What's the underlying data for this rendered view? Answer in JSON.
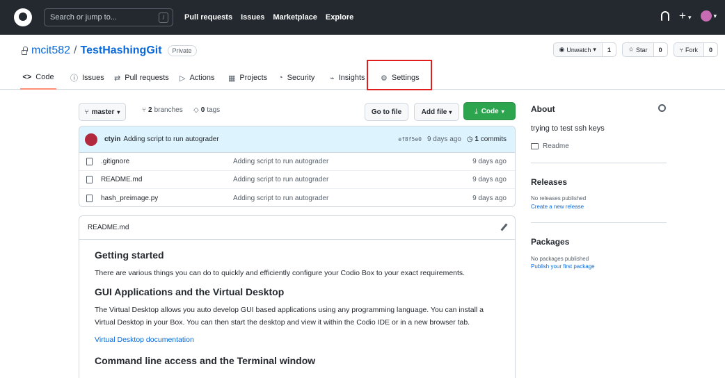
{
  "topbar": {
    "search_placeholder": "Search or jump to...",
    "slash_key": "/",
    "nav": [
      "Pull requests",
      "Issues",
      "Marketplace",
      "Explore"
    ],
    "plus_icon": "+"
  },
  "repo": {
    "owner": "mcit582",
    "separator": "/",
    "name": "TestHashingGit",
    "visibility": "Private",
    "unwatch_label": "Unwatch",
    "unwatch_count": "1",
    "star_label": "Star",
    "star_count": "0",
    "fork_label": "Fork",
    "fork_count": "0"
  },
  "tabs": [
    {
      "label": "Code",
      "icon": "<>"
    },
    {
      "label": "Issues",
      "icon": "ⓘ"
    },
    {
      "label": "Pull requests",
      "icon": "⇄"
    },
    {
      "label": "Actions",
      "icon": "▷"
    },
    {
      "label": "Projects",
      "icon": "▦"
    },
    {
      "label": "Security",
      "icon": "◔"
    },
    {
      "label": "Insights",
      "icon": "⌁"
    },
    {
      "label": "Settings",
      "icon": "⚙"
    }
  ],
  "toolbar": {
    "branch": "master",
    "branches_count": "2",
    "branches_label": "branches",
    "tags_count": "0",
    "tags_label": "tags",
    "go_to_file": "Go to file",
    "add_file": "Add file",
    "code": "Code"
  },
  "commit": {
    "author": "ctyin",
    "message": "Adding script to run autograder",
    "sha": "ef8f5e0",
    "age": "9 days ago",
    "commits_count": "1",
    "commits_label": "commits"
  },
  "files": [
    {
      "name": ".gitignore",
      "commit": "Adding script to run autograder",
      "age": "9 days ago"
    },
    {
      "name": "README.md",
      "commit": "Adding script to run autograder",
      "age": "9 days ago"
    },
    {
      "name": "hash_preimage.py",
      "commit": "Adding script to run autograder",
      "age": "9 days ago"
    }
  ],
  "readme": {
    "filename": "README.md",
    "h1": "Getting started",
    "p1": "There are various things you can do to quickly and efficiently configure your Codio Box to your exact requirements.",
    "h2": "GUI Applications and the Virtual Desktop",
    "p2": "The Virtual Desktop allows you auto develop GUI based applications using any programming language. You can install a Virtual Desktop in your Box. You can then start the desktop and view it within the Codio IDE or in a new browser tab.",
    "link": "Virtual Desktop documentation",
    "h3": "Command line access and the Terminal window"
  },
  "sidebar": {
    "about": "About",
    "description": "trying to test ssh keys",
    "readme": "Readme",
    "releases": "Releases",
    "releases_none": "No releases published",
    "releases_create": "Create a new release",
    "packages": "Packages",
    "packages_none": "No packages published",
    "packages_publish": "Publish your first package"
  }
}
